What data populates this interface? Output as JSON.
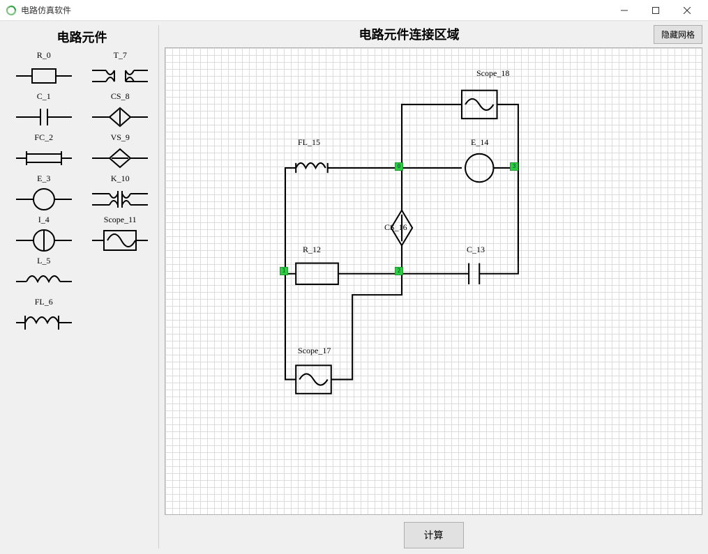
{
  "window": {
    "title": "电路仿真软件",
    "minimize_icon": "—",
    "close_icon": "✕"
  },
  "palette": {
    "title": "电路元件",
    "items": [
      {
        "label": "R_0",
        "kind": "resistor"
      },
      {
        "label": "T_7",
        "kind": "transformer"
      },
      {
        "label": "C_1",
        "kind": "capacitor"
      },
      {
        "label": "CS_8",
        "kind": "csrc_v"
      },
      {
        "label": "FC_2",
        "kind": "fc"
      },
      {
        "label": "VS_9",
        "kind": "csrc_h"
      },
      {
        "label": "E_3",
        "kind": "circle"
      },
      {
        "label": "K_10",
        "kind": "transformer2"
      },
      {
        "label": "I_4",
        "kind": "circle_pipe"
      },
      {
        "label": "Scope_11",
        "kind": "scope"
      },
      {
        "label": "L_5",
        "kind": "inductor"
      },
      {
        "label": "",
        "kind": ""
      },
      {
        "label": "FL_6",
        "kind": "fl"
      },
      {
        "label": "",
        "kind": ""
      }
    ]
  },
  "canvas": {
    "title": "电路元件连接区域",
    "hide_grid_button": "隐藏网格",
    "compute_button": "计算",
    "components": {
      "Scope_18": "Scope_18",
      "E_14": "E_14",
      "FL_15": "FL_15",
      "R_12": "R_12",
      "CS_16": "CS_16",
      "C_13": "C_13",
      "Scope_17": "Scope_17"
    },
    "nodes": [
      "0",
      "1",
      "2",
      "3"
    ]
  }
}
